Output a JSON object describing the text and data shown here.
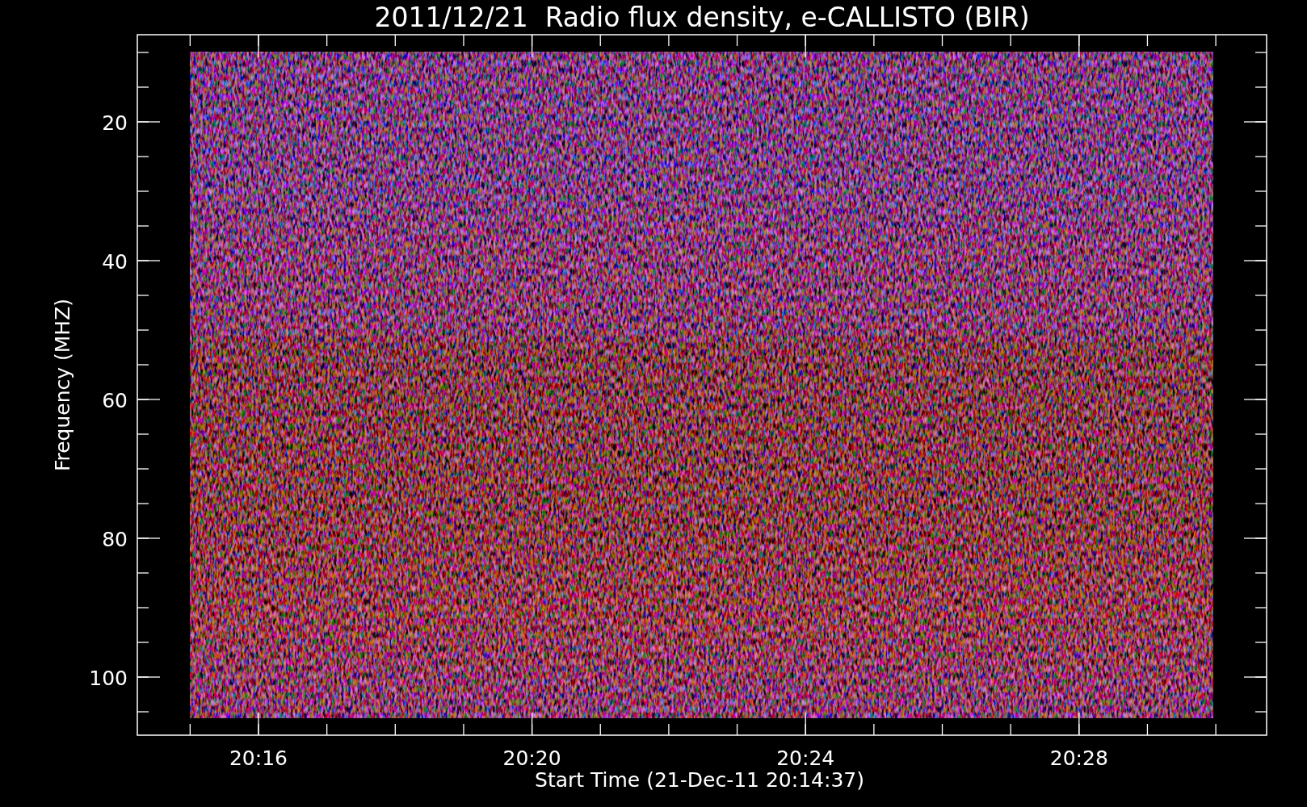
{
  "title": "2011/12/21  Radio flux density, e-CALLISTO (BIR)",
  "y_axis": {
    "label": "Frequency (MHZ)",
    "ticks": [
      "20",
      "40",
      "60",
      "80",
      "100"
    ]
  },
  "x_axis": {
    "label": "Start Time (21-Dec-11 20:14:37)",
    "ticks": [
      "20:16",
      "20:20",
      "20:24",
      "20:28"
    ]
  }
}
